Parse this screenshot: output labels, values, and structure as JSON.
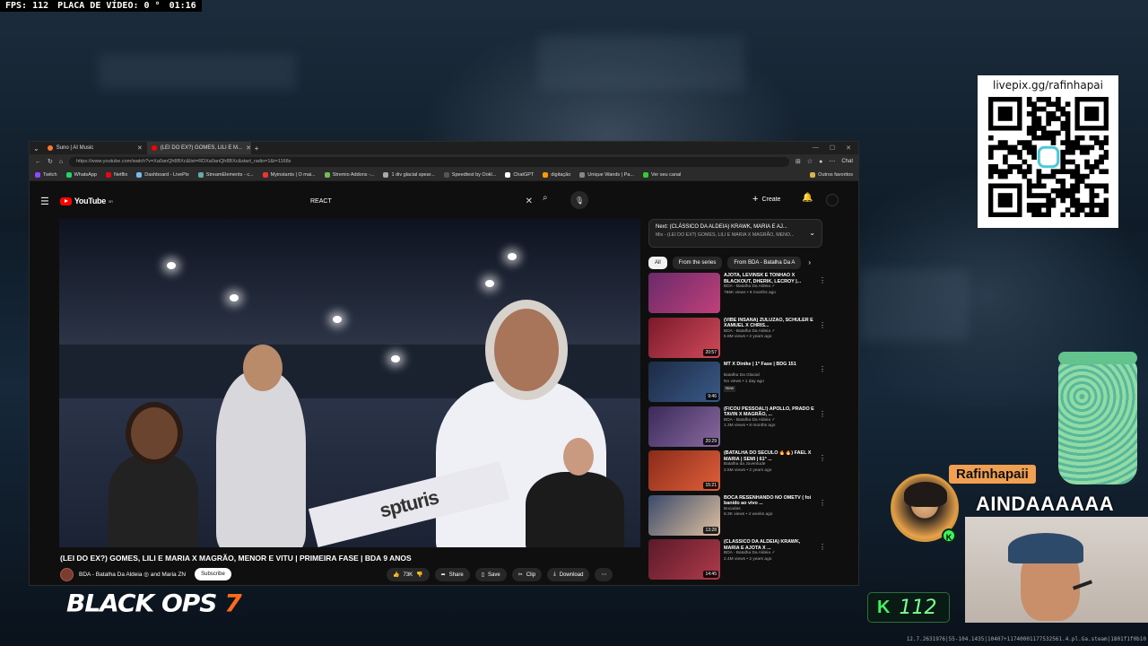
{
  "hud": {
    "fps": "FPS: 112",
    "gpu": "PLACA DE VÍDEO: 0 °",
    "time": "01:16"
  },
  "browser": {
    "tabs": [
      {
        "label": "Suno | AI Music",
        "color": "#ff7a2e"
      },
      {
        "label": "(LEI DO EX?) GOMES, LILI E M...",
        "color": "#ff0000"
      }
    ],
    "url": "https://www.youtube.com/watch?v=Xa0anQh8BXc&list=RDXa0anQh8BXc&start_radio=1&t=1168s",
    "chat_label": "Chat",
    "bookmarks": [
      {
        "label": "Twitch",
        "color": "#9146ff"
      },
      {
        "label": "WhatsApp",
        "color": "#25d366"
      },
      {
        "label": "Netflix",
        "color": "#e50914"
      },
      {
        "label": "Dashboard - LivePix",
        "color": "#7be"
      },
      {
        "label": "StreamElements - c...",
        "color": "#6aa"
      },
      {
        "label": "Myinstants | O mai...",
        "color": "#e33"
      },
      {
        "label": "Stremio Addons -...",
        "color": "#7b5"
      },
      {
        "label": "1 div glacial spear...",
        "color": "#aaa"
      },
      {
        "label": "Speedtest by Ookl...",
        "color": "#333"
      },
      {
        "label": "ChatGPT",
        "color": "#fff"
      },
      {
        "label": "digitação",
        "color": "#f90"
      },
      {
        "label": "Unique Wands | Pa...",
        "color": "#888"
      },
      {
        "label": "Ver seu canal",
        "color": "#3c3"
      }
    ],
    "bookmarks_other": "Outros favoritos"
  },
  "youtube": {
    "logo": "YouTube",
    "logo_region": "BR",
    "search_value": "REACT",
    "create_label": "Create",
    "video_title": "(LEI DO EX?) GOMES, LILI E MARIA X MAGRÃO, MENOR E VITU | PRIMEIRA FASE | BDA 9 ANOS",
    "channel_line": "BDA - Batalha Da Aldeia ◎ and Maria ZN",
    "subscribe_label": "Subscribe",
    "likes": "73K",
    "share_label": "Share",
    "save_label": "Save",
    "clip_label": "Clip",
    "download_label": "Download",
    "banner_text": "spturis",
    "next": {
      "title": "Next: (CLÁSSICO DA ALDEIA) KRAWK, MARIA E AJ...",
      "sub": "Mix - (LEI DO EX?) GOMES, LILI E MARIA X MAGRÃO, MENO..."
    },
    "chips": [
      {
        "label": "All",
        "on": true
      },
      {
        "label": "From the series",
        "on": false
      },
      {
        "label": "From BDA - Batalha Da A",
        "on": false
      }
    ],
    "recs": [
      {
        "title": "AJOTA, LEVINSK E TONHÃO X BLACKOUT, DHERIK, LECROY |...",
        "channel": "BDA - Batalha Da Aldeia ✓",
        "meta": "786K views • 8 months ago",
        "dur": "",
        "badge": "",
        "colors": [
          "#6a2a6a",
          "#c0407a"
        ]
      },
      {
        "title": "(VIBE INSANA) ZULUZÃO, SCHULER E XAMUEL X CHRIS...",
        "channel": "BDA - Batalha Da Aldeia ✓",
        "meta": "6.8M views • 2 years ago",
        "dur": "20:57",
        "badge": "",
        "colors": [
          "#7a1a2a",
          "#d04a5a"
        ]
      },
      {
        "title": "MT X Dinike | 1ª Fase | BDG 151",
        "channel": "Batalha Da Glacial",
        "meta": "No views • 1 day ago",
        "dur": "9:46",
        "badge": "New",
        "colors": [
          "#1c2a44",
          "#3a5a88"
        ]
      },
      {
        "title": "(FICOU PESSOAL!) APOLLO, PRADO E TAVIN X MAGRÃO, ...",
        "channel": "BDA - Batalha Da Aldeia ✓",
        "meta": "1.3M views • 8 months ago",
        "dur": "20:29",
        "badge": "",
        "colors": [
          "#3a2a5a",
          "#8a6aa0"
        ]
      },
      {
        "title": "(BATALHA DO SÉCULO 🔥🔥) FAEL X MARIA | SEMI | 61ª ...",
        "channel": "Batalha da Juventude",
        "meta": "2.5M views • 2 years ago",
        "dur": "15:21",
        "badge": "",
        "colors": [
          "#8a2a1a",
          "#e0603a"
        ]
      },
      {
        "title": "BOCA RESENHANDO NO OMETV ( foi banido ao vivo ...",
        "channel": "Bocadas",
        "meta": "8.3K views • 4 weeks ago",
        "dur": "13:28",
        "badge": "",
        "colors": [
          "#3a4a6a",
          "#e0c0a0"
        ]
      },
      {
        "title": "(CLÁSSICO DA ALDEIA) KRAWK, MARIA E AJOTA X ...",
        "channel": "BDA - Batalha Da Aldeia ✓",
        "meta": "2.4M views • 2 years ago",
        "dur": "14:45",
        "badge": "",
        "colors": [
          "#5a1a2a",
          "#b03a4a"
        ]
      }
    ]
  },
  "overlays": {
    "qr_url": "livepix.gg/rafinhapai",
    "game_logo": "BLACK OPS",
    "game_logo_num": "7",
    "fps_icon": "K",
    "fps_num": "112",
    "streamer_name": "Rafinhapaii",
    "shout": "AINDAAAAAA",
    "status": "12.7.2631976|55-104.1435|10407+11740001177532561.4.pl.Ga.steam|1801f1f0b10"
  }
}
